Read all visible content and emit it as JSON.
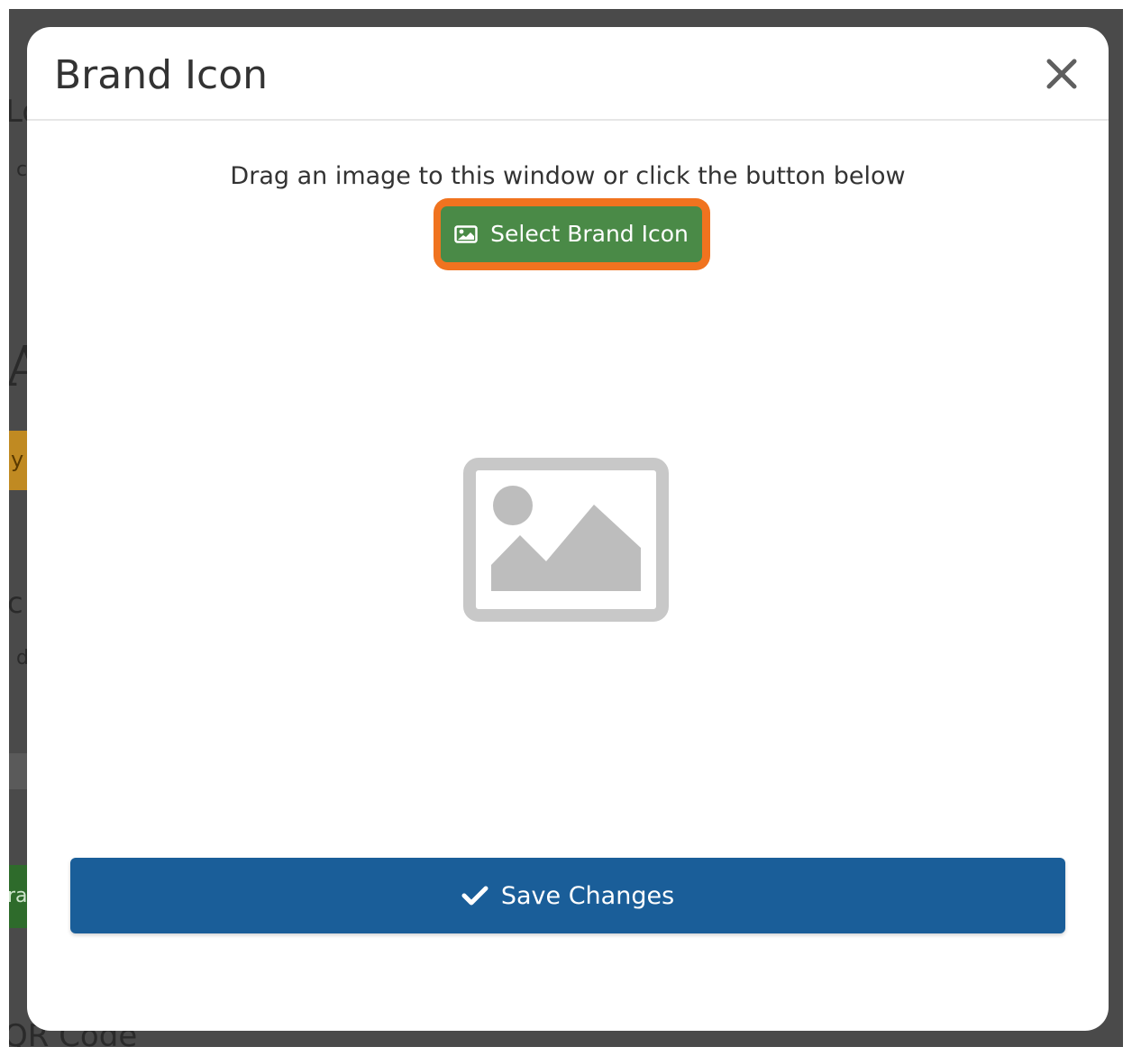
{
  "background_fragments": {
    "top_text": "Lo",
    "text_1": "c",
    "letter": "A",
    "badge_text": "y",
    "text_2": "c",
    "text_3": "d",
    "green_text": "ra",
    "bottom_text": "QR Code"
  },
  "modal": {
    "title": "Brand Icon",
    "close_symbol": "×",
    "instructions": "Drag an image to this window or click the button below",
    "select_button": {
      "label": "Select Brand Icon",
      "icon": "image-icon",
      "highlight_color": "#f0731f",
      "color": "#4a8a47"
    },
    "placeholder_icon": "image-placeholder-icon",
    "save_button": {
      "label": "Save Changes",
      "icon": "check-icon",
      "color": "#1a5e99"
    }
  }
}
